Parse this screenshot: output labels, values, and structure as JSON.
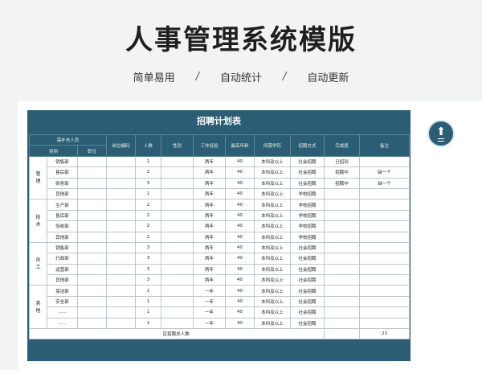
{
  "header": {
    "title": "人事管理系统模版",
    "features": [
      "简单易用",
      "自动统计",
      "自动更新"
    ],
    "separator": "/"
  },
  "sheet": {
    "title": "招聘计划表",
    "headers": {
      "needs": "需补充人员",
      "category": "类别",
      "position": "职位",
      "code": "岗位编码",
      "count": "人数",
      "gender": "性别",
      "experience": "工作经验",
      "max_age": "最高年龄",
      "education": "所需学历",
      "method": "招聘方式",
      "status": "完成度",
      "remark": "备注"
    },
    "groups": [
      {
        "category": "管\n理",
        "rows": [
          {
            "dept": "销售部",
            "count": "1",
            "exp": "两年",
            "age": "40",
            "edu": "本科及以上",
            "method": "社会招聘",
            "status": "已招到",
            "remark": ""
          },
          {
            "dept": "售后部",
            "count": "2",
            "exp": "两年",
            "age": "40",
            "edu": "本科及以上",
            "method": "社会招聘",
            "status": "招聘中",
            "remark": "缺一个"
          },
          {
            "dept": "财务部",
            "count": "3",
            "exp": "两年",
            "age": "40",
            "edu": "本科及以上",
            "method": "社会招聘",
            "status": "招聘中",
            "remark": "缺一个"
          },
          {
            "dept": "其他部",
            "count": "1",
            "exp": "两年",
            "age": "40",
            "edu": "本科及以上",
            "method": "学校招聘",
            "status": "",
            "remark": ""
          }
        ]
      },
      {
        "category": "技\n术",
        "rows": [
          {
            "dept": "生产部",
            "count": "2",
            "exp": "两年",
            "age": "40",
            "edu": "本科及以上",
            "method": "学校招聘",
            "status": "",
            "remark": ""
          },
          {
            "dept": "售后部",
            "count": "2",
            "exp": "两年",
            "age": "40",
            "edu": "本科及以上",
            "method": "学校招聘",
            "status": "",
            "remark": ""
          },
          {
            "dept": "验收部",
            "count": "2",
            "exp": "两年",
            "age": "40",
            "edu": "本科及以上",
            "method": "学校招聘",
            "status": "",
            "remark": ""
          },
          {
            "dept": "其他部",
            "count": "2",
            "exp": "两年",
            "age": "40",
            "edu": "本科及以上",
            "method": "学校招聘",
            "status": "",
            "remark": ""
          }
        ]
      },
      {
        "category": "员\n工",
        "rows": [
          {
            "dept": "销售部",
            "count": "3",
            "exp": "两年",
            "age": "40",
            "edu": "本科及以上",
            "method": "社会招聘",
            "status": "",
            "remark": ""
          },
          {
            "dept": "行政部",
            "count": "3",
            "exp": "两年",
            "age": "40",
            "edu": "本科及以上",
            "method": "社会招聘",
            "status": "",
            "remark": ""
          },
          {
            "dept": "运营部",
            "count": "3",
            "exp": "两年",
            "age": "40",
            "edu": "本科及以上",
            "method": "社会招聘",
            "status": "",
            "remark": ""
          },
          {
            "dept": "其他部",
            "count": "3",
            "exp": "两年",
            "age": "40",
            "edu": "本科及以上",
            "method": "社会招聘",
            "status": "",
            "remark": ""
          }
        ]
      },
      {
        "category": "其\n他",
        "rows": [
          {
            "dept": "保洁部",
            "count": "1",
            "exp": "一年",
            "age": "40",
            "edu": "本科及以上",
            "method": "社会招聘",
            "status": "",
            "remark": ""
          },
          {
            "dept": "安全部",
            "count": "1",
            "exp": "一年",
            "age": "40",
            "edu": "本科及以上",
            "method": "社会招聘",
            "status": "",
            "remark": ""
          },
          {
            "dept": "......",
            "count": "1",
            "exp": "一年",
            "age": "40",
            "edu": "本科及以上",
            "method": "社会招聘",
            "status": "",
            "remark": ""
          },
          {
            "dept": "......",
            "count": "1",
            "exp": "一年",
            "age": "40",
            "edu": "本科及以上",
            "method": "社会招聘",
            "status": "",
            "remark": ""
          }
        ]
      }
    ],
    "total_label": "应招聘总人数:",
    "total_value": "23"
  },
  "colors": {
    "header_bg": "#2b5d74",
    "page_bg": "#f1f3f4"
  },
  "icons": {
    "back_to_top": "arrow-up-icon"
  }
}
